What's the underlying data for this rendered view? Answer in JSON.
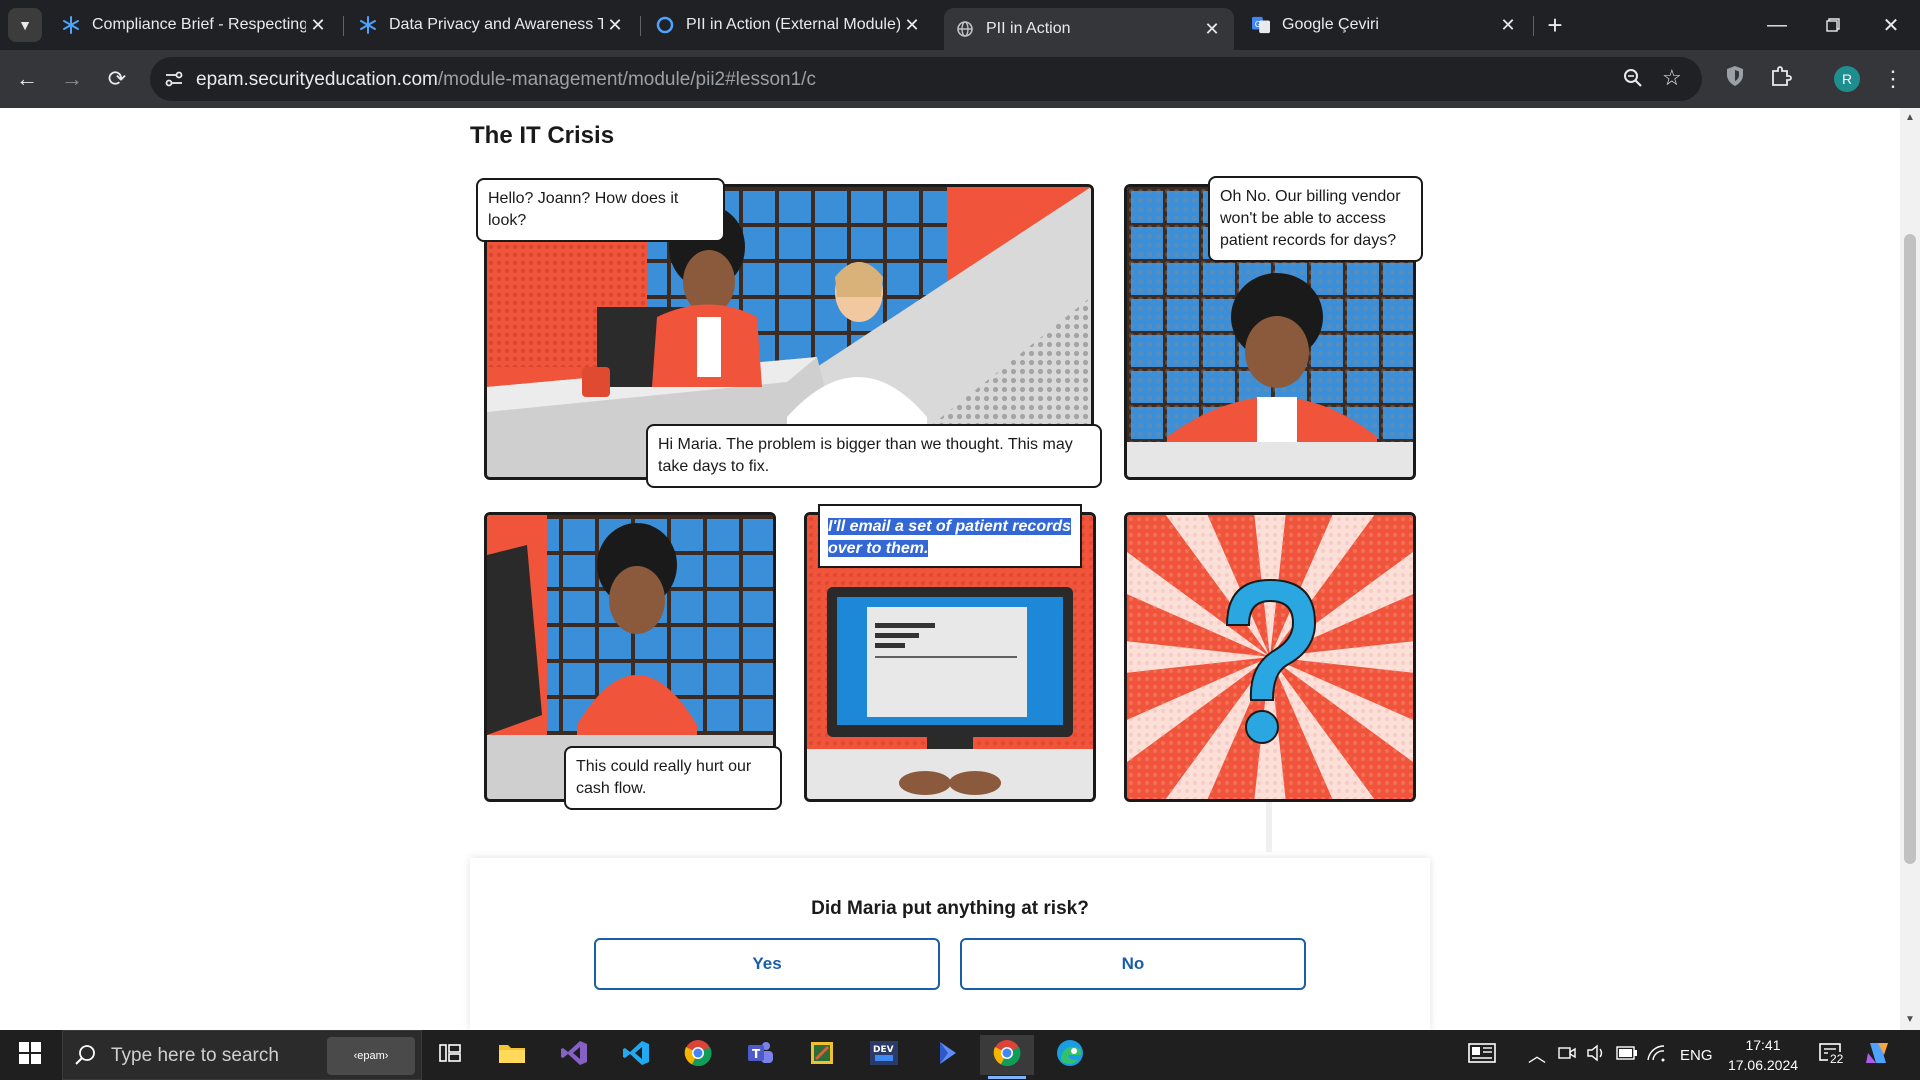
{
  "browser": {
    "tabs": [
      {
        "title": "Compliance Brief - Respecting C",
        "active": false
      },
      {
        "title": "Data Privacy and Awareness Tra",
        "active": false
      },
      {
        "title": "PII in Action (External Module) |",
        "active": false
      },
      {
        "title": "PII in Action",
        "active": true
      },
      {
        "title": "Google Çeviri",
        "active": false
      }
    ],
    "url_host": "epam.securityeducation.com",
    "url_path": "/module-management/module/pii2#lesson1/c",
    "profile_initial": "R"
  },
  "lesson": {
    "title": "The IT Crisis",
    "bubbles": {
      "b1": "Hello? Joann? How does it look?",
      "b2": "Hi Maria. The problem is bigger than we thought. This may take days to fix.",
      "b3": "Oh No. Our billing vendor won't be able to access patient records for days?",
      "b4": "This could really hurt our cash flow.",
      "b5": "I'll email a set of patient records over to them."
    }
  },
  "quiz": {
    "question": "Did Maria put anything at risk?",
    "yes": "Yes",
    "no": "No"
  },
  "taskbar": {
    "search_placeholder": "Type here to search",
    "epam_label": "‹epam›",
    "lang": "ENG",
    "time": "17:41",
    "date": "17.06.2024",
    "notif_count": "22"
  },
  "colors": {
    "accent_blue": "#1a5ea8",
    "comic_orange": "#f0543a",
    "selection": "#3367d6"
  }
}
